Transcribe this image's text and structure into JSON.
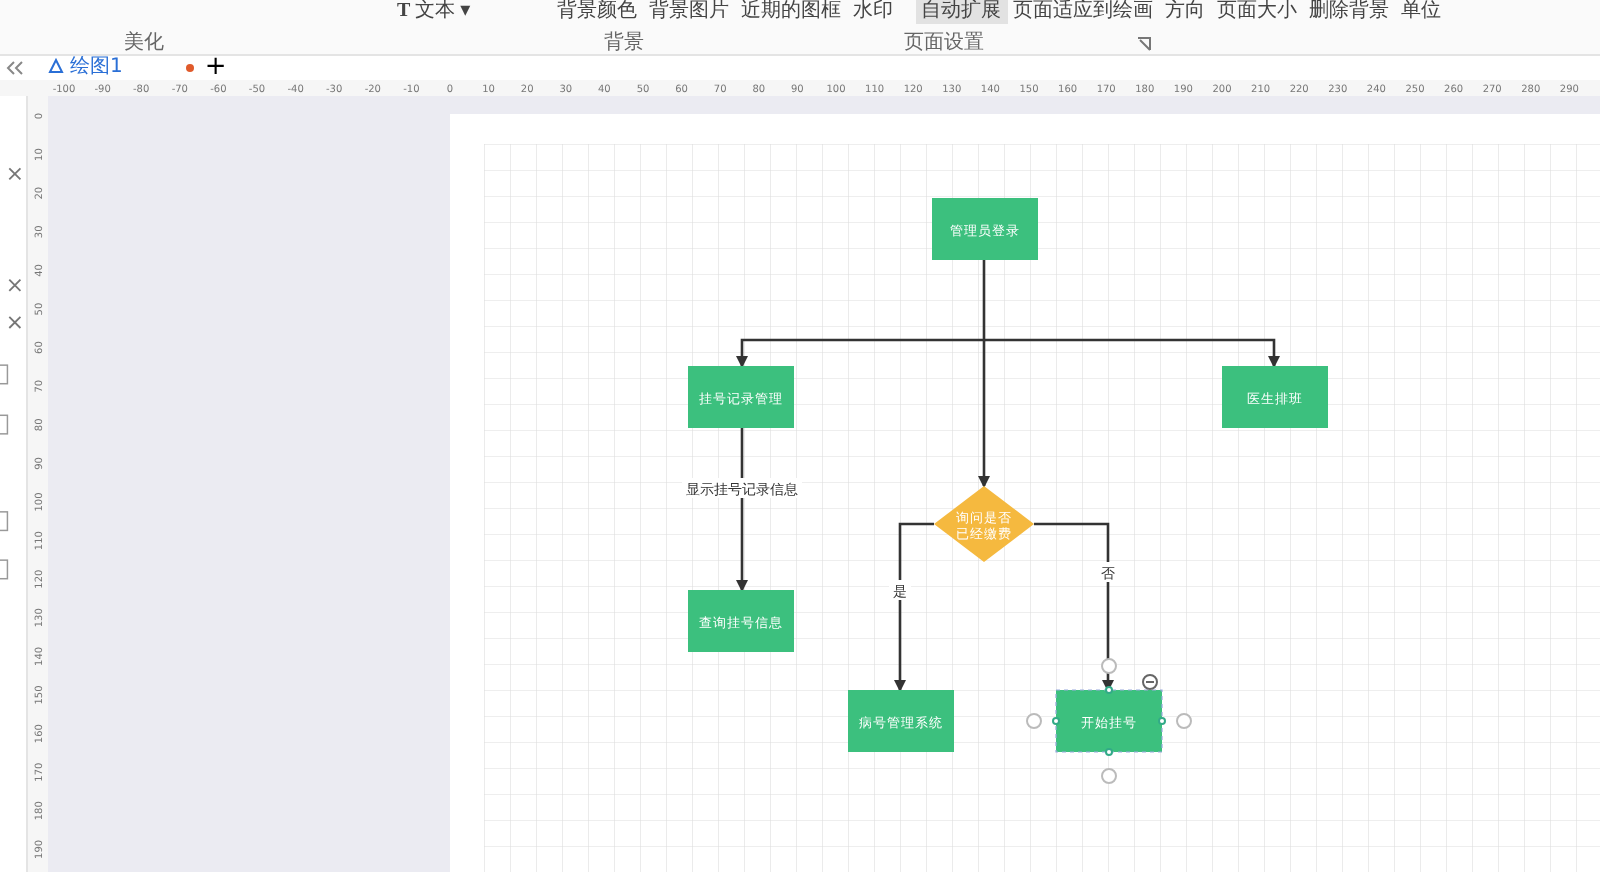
{
  "ribbon": {
    "text_button": {
      "icon": "T",
      "label": "文本",
      "kind": "dropdown",
      "caret": "▾"
    },
    "background_items": [
      {
        "label": "背景颜色"
      },
      {
        "label": "背景图片"
      },
      {
        "label": "近期的图框"
      },
      {
        "label": "水印"
      }
    ],
    "page_setup_items": [
      {
        "label": "自动扩展",
        "selected": true
      },
      {
        "label": "页面适应到绘画",
        "selected": false
      },
      {
        "label": "方向",
        "selected": false
      },
      {
        "label": "页面大小",
        "selected": false
      },
      {
        "label": "删除背景",
        "selected": false
      },
      {
        "label": "单位",
        "selected": false
      }
    ],
    "groups": [
      "美化",
      "背景",
      "页面设置"
    ]
  },
  "tabs": [
    {
      "label": "绘图1",
      "selected": true,
      "unsaved": true
    }
  ],
  "add_tab": "+",
  "rulers": {
    "horizontal": [
      "-100",
      "-90",
      "-80",
      "-70",
      "-60",
      "-50",
      "-40",
      "-30",
      "-20",
      "-10",
      "0",
      "10",
      "20",
      "30",
      "40",
      "50",
      "60",
      "70",
      "80",
      "90",
      "100",
      "110",
      "120",
      "130",
      "140",
      "150",
      "160",
      "170",
      "180",
      "190",
      "200",
      "210",
      "220",
      "230",
      "240",
      "250",
      "260",
      "270",
      "280",
      "290"
    ],
    "vertical": [
      "0",
      "10",
      "20",
      "30",
      "40",
      "50",
      "60",
      "70",
      "80",
      "90",
      "100",
      "110",
      "120",
      "130",
      "140",
      "150",
      "160",
      "170",
      "180",
      "190"
    ]
  },
  "diagram": {
    "nodes": [
      {
        "kind": "process",
        "label": "管理员登录",
        "selected": false
      },
      {
        "kind": "process",
        "label": "挂号记录管理",
        "selected": false
      },
      {
        "kind": "process",
        "label": "医生排班",
        "selected": false
      },
      {
        "kind": "decision",
        "label": "询问是否已经缴费",
        "selected": false
      },
      {
        "kind": "process",
        "label": "查询挂号信息",
        "selected": false
      },
      {
        "kind": "process",
        "label": "病号管理系统",
        "selected": false
      },
      {
        "kind": "process",
        "label": "开始挂号",
        "selected": true
      }
    ],
    "edge_labels": [
      "显示挂号记录信息",
      "是",
      "否"
    ]
  }
}
